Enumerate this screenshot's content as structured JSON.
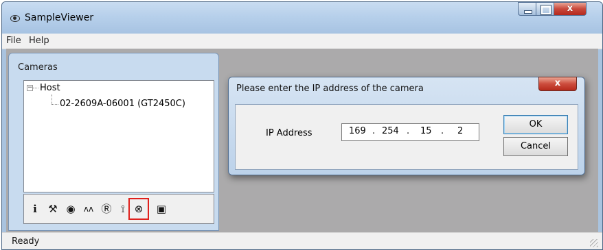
{
  "window": {
    "title": "SampleViewer",
    "min": "",
    "max": "",
    "close": "x"
  },
  "menu": [
    "File",
    "Help"
  ],
  "cameras": {
    "label": "Cameras",
    "toggle": "−",
    "host": "Host",
    "camera": "02-2609A-06001 (GT2450C)"
  },
  "toolbar": {
    "tools": [
      {
        "icon": "info-icon",
        "glyph": "i"
      },
      {
        "icon": "wrench-icon",
        "glyph": "⚒"
      },
      {
        "icon": "eye-icon",
        "glyph": "◉"
      },
      {
        "icon": "histogram-icon",
        "glyph": "ʌʌ"
      },
      {
        "icon": "register-icon",
        "glyph": "Ⓡ"
      },
      {
        "icon": "center-icon",
        "glyph": "⟟"
      },
      {
        "icon": "ip-config-icon",
        "glyph": "⊗",
        "selected": true
      },
      {
        "icon": "save-icon",
        "glyph": "▣"
      }
    ]
  },
  "status": "Ready",
  "dialog": {
    "title": "Please enter the IP address of the camera",
    "close": "x",
    "ip_label": "IP Address",
    "ip": [
      "169",
      "254",
      "15",
      "2"
    ],
    "ok": "OK",
    "cancel": "Cancel"
  },
  "colors": {
    "highlight": "#e0201c",
    "close_red": "#c9483b",
    "panel_blue": "#c8dbef"
  }
}
